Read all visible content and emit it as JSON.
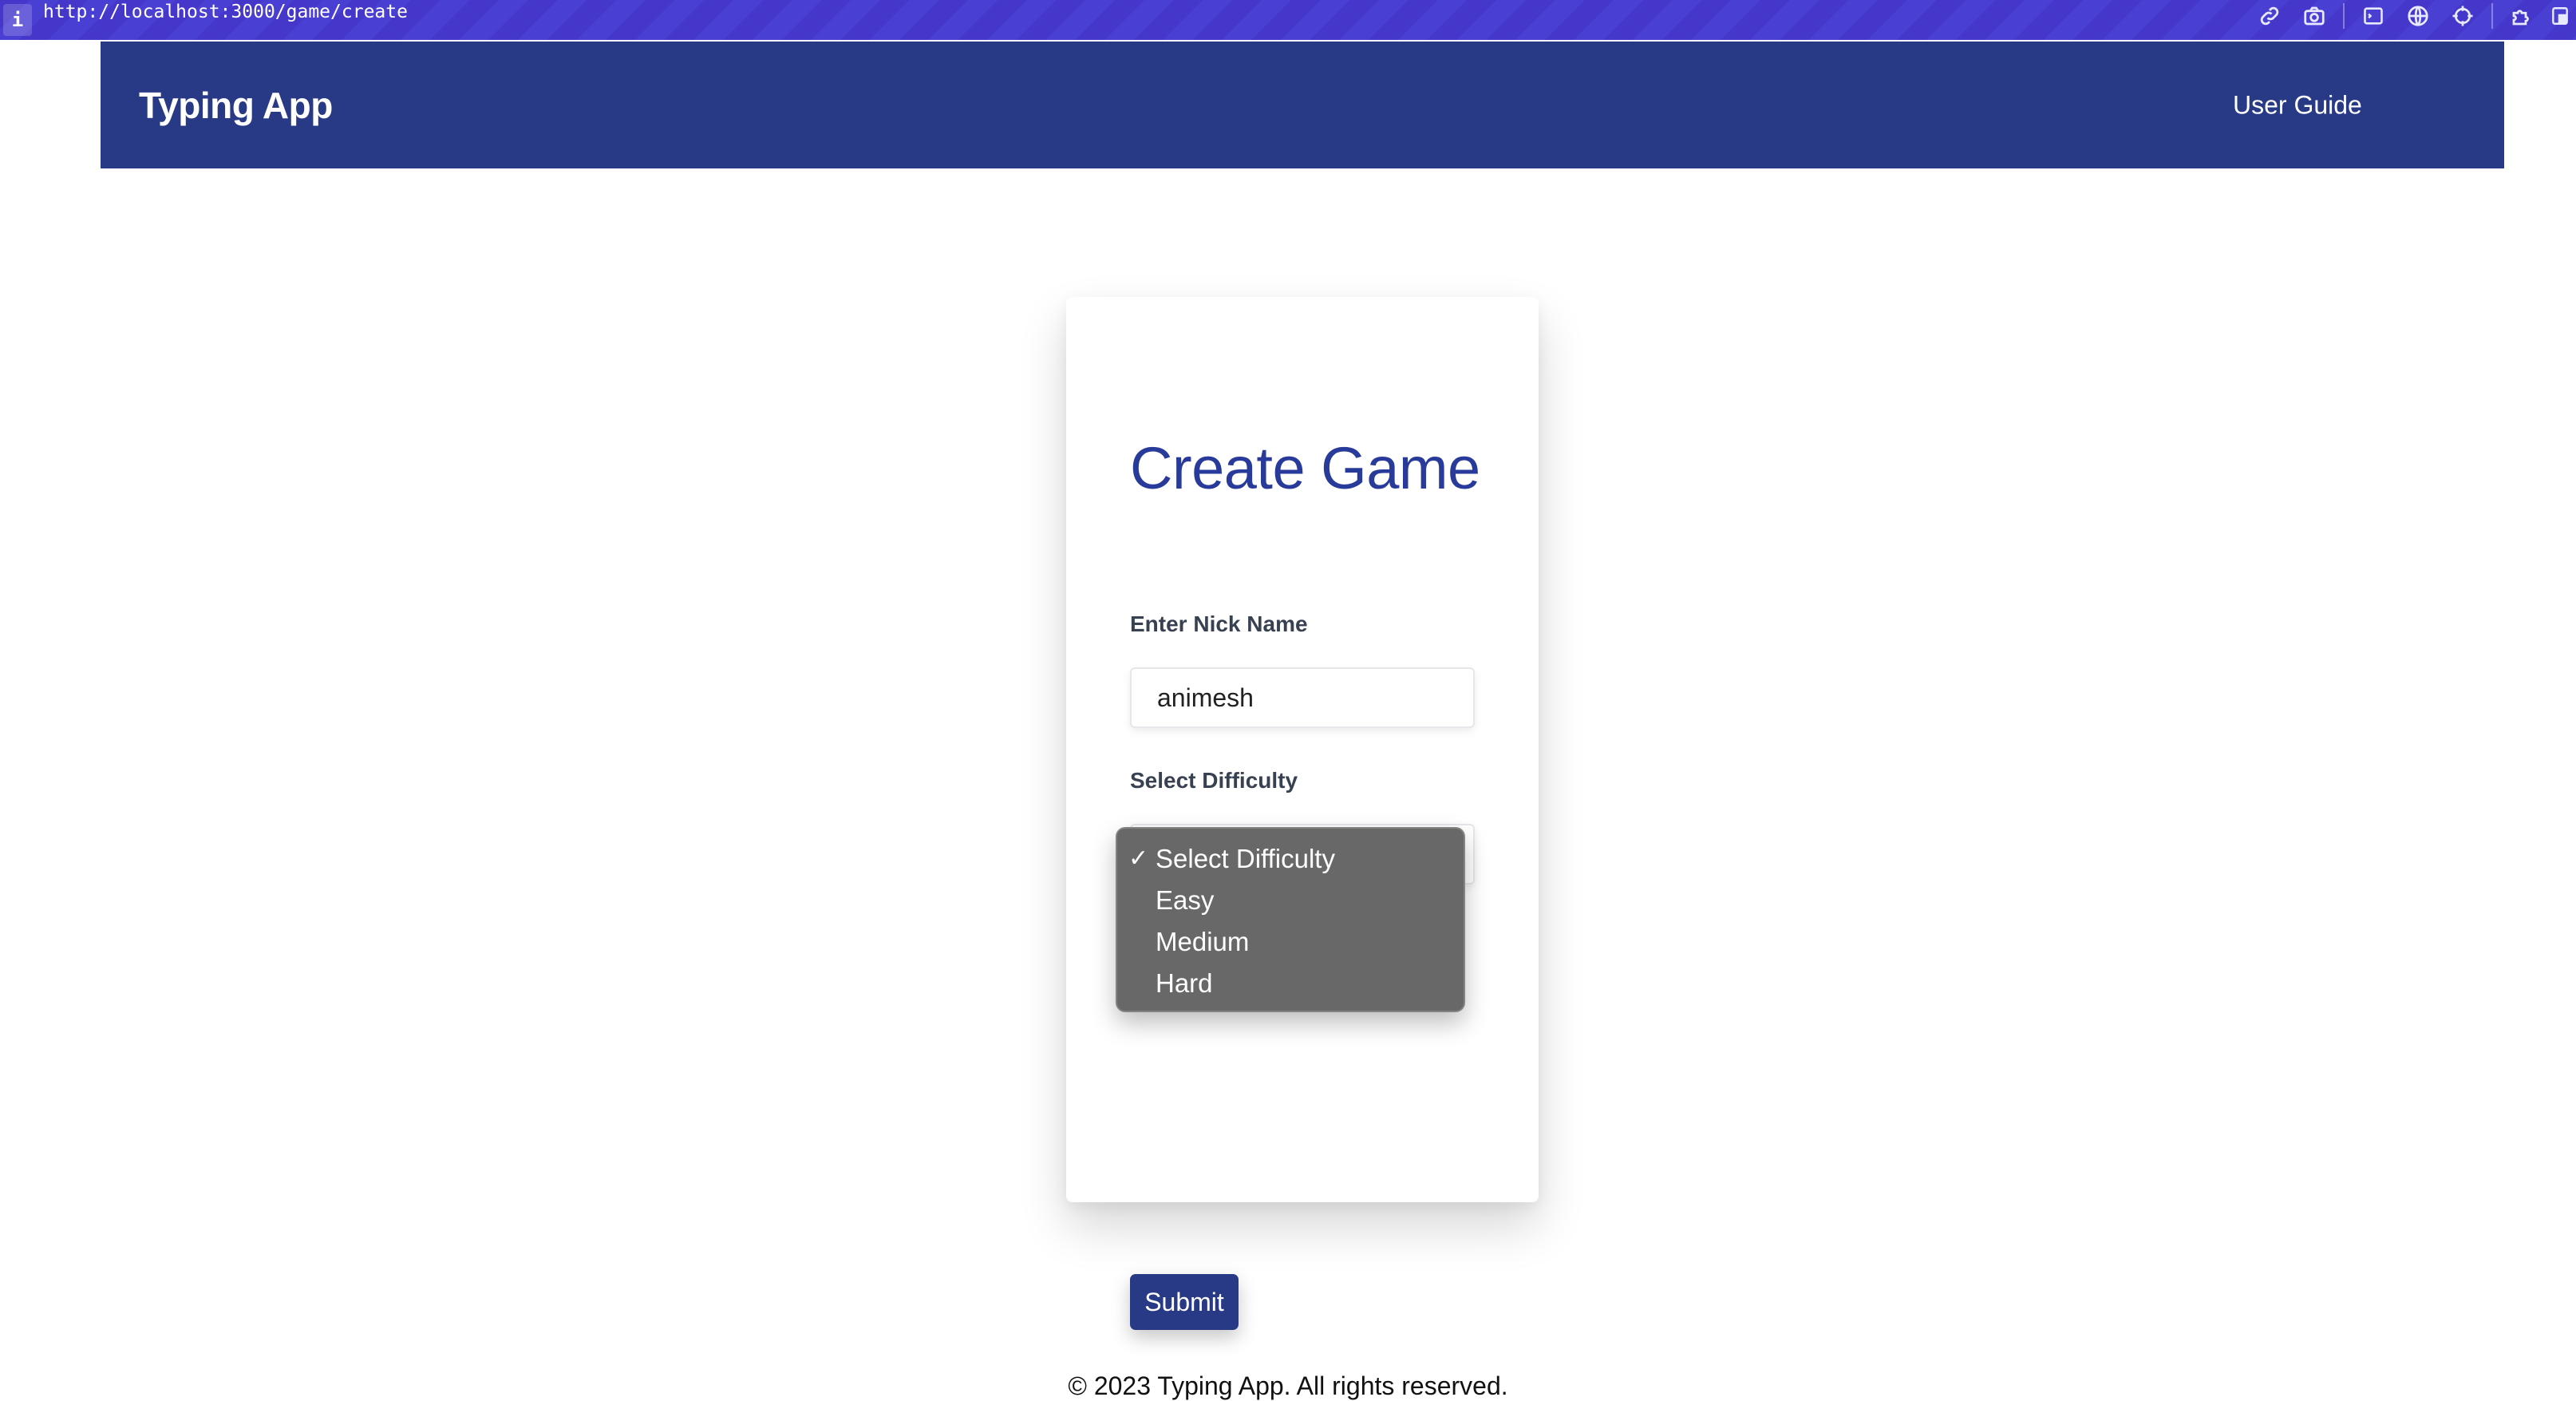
{
  "browser": {
    "info_glyph": "i",
    "url": "http://localhost:3000/game/create"
  },
  "header": {
    "brand": "Typing App",
    "nav_user_guide": "User Guide",
    "color": "#283a86"
  },
  "form": {
    "title": "Create Game",
    "nick_label": "Enter Nick Name",
    "nick_value": "animesh",
    "difficulty_label": "Select Difficulty",
    "difficulty_options": [
      "Select Difficulty",
      "Easy",
      "Medium",
      "Hard"
    ],
    "difficulty_selected": "Select Difficulty",
    "submit_label": "Submit"
  },
  "dropdown": {
    "check_glyph": "✓",
    "options": [
      {
        "label": "Select Difficulty",
        "selected": true
      },
      {
        "label": "Easy",
        "selected": false
      },
      {
        "label": "Medium",
        "selected": false
      },
      {
        "label": "Hard",
        "selected": false
      }
    ]
  },
  "footer": {
    "text": "© 2023 Typing App. All rights reserved."
  },
  "icons": {
    "toolbar": [
      "link-icon",
      "camera-icon",
      "terminal-icon",
      "globe-icon",
      "crosshair-icon",
      "extension-icon",
      "account-icon"
    ],
    "theme_toggle": "moon-icon"
  }
}
